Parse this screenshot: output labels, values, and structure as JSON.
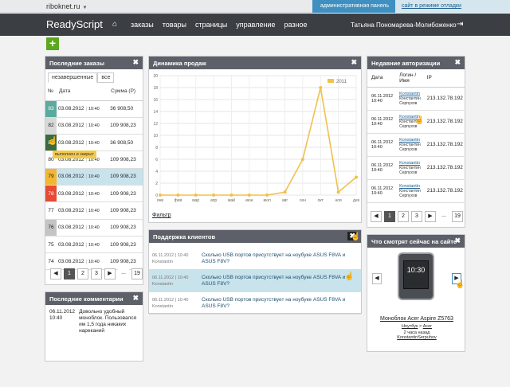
{
  "topbar": {
    "site": "riboknet.ru",
    "admin_link": "административная панель",
    "view_link": "сайт в режиме отладки"
  },
  "navbar": {
    "logo": "ReadyScript",
    "menu": [
      "заказы",
      "товары",
      "страницы",
      "управление",
      "разное"
    ],
    "user": "Татьяна Пономарева-Молибоженко"
  },
  "orders": {
    "title": "Последние заказы",
    "tabs": [
      "незавершенные",
      "все"
    ],
    "columns": [
      "№",
      "Дата",
      "Сумма (Р)"
    ],
    "rows": [
      {
        "num": "83",
        "date": "03.08.2012",
        "time": "10:40",
        "sum": "36 908,50",
        "color": "#5aaa9f"
      },
      {
        "num": "82",
        "date": "03.08.2012",
        "time": "10:40",
        "sum": "109 908,23",
        "color": "#d8d8d8"
      },
      {
        "num": "81",
        "date": "03.08.2012",
        "time": "10:40",
        "sum": "36 908,50",
        "color": "#3a6b3e"
      },
      {
        "num": "80",
        "date": "03.08.2012",
        "time": "10:40",
        "sum": "109 908,23",
        "color": "#ffffff"
      },
      {
        "num": "79",
        "date": "03.08.2012",
        "time": "10:40",
        "sum": "109 908,23",
        "color": "#f2b632"
      },
      {
        "num": "78",
        "date": "03.08.2012",
        "time": "10:40",
        "sum": "109 908,23",
        "color": "#e64b36"
      },
      {
        "num": "77",
        "date": "03.08.2012",
        "time": "10:40",
        "sum": "109 908,23",
        "color": "#ffffff"
      },
      {
        "num": "76",
        "date": "03.08.2012",
        "time": "10:40",
        "sum": "109 908,23",
        "color": "#c4c4c4"
      },
      {
        "num": "75",
        "date": "03.08.2012",
        "time": "10:40",
        "sum": "109 908,23",
        "color": "#ffffff"
      },
      {
        "num": "74",
        "date": "03.08.2012",
        "time": "10:40",
        "sum": "109 908,23",
        "color": "#ffffff"
      }
    ],
    "tooltip": "выполнен и закрыт",
    "pager": [
      "◀",
      "1",
      "2",
      "3",
      "▶",
      "...",
      "19"
    ]
  },
  "comments": {
    "title": "Последние комментарии",
    "items": [
      {
        "date": "06.11.2012",
        "time": "10:40",
        "text": "Довольно удобный моноблок. Пользовался им 1,5 года никаких нареканий"
      }
    ]
  },
  "sales": {
    "title": "Динамика продаж",
    "filter": "Фильтр"
  },
  "chart_data": {
    "type": "line",
    "categories": [
      "янв",
      "фев",
      "мар",
      "апр",
      "май",
      "июн",
      "июл",
      "авг",
      "сен",
      "окт",
      "ноя",
      "дек"
    ],
    "series": [
      {
        "name": "2011",
        "values": [
          0,
          0,
          0,
          0,
          0,
          0,
          0,
          0.5,
          6,
          18,
          0.5,
          3
        ]
      }
    ],
    "ylim": [
      0,
      20
    ],
    "yticks": [
      0,
      2,
      4,
      6,
      8,
      10,
      12,
      14,
      16,
      18,
      20
    ],
    "legend": "top-right",
    "grid": true,
    "color": "#f0c14b"
  },
  "support": {
    "title": "Поддержка клиентов",
    "items": [
      {
        "date": "06.11.2012",
        "time": "10:40",
        "user": "Konstantin",
        "text": "Сколько USB портов присутствует на ноубуке ASUS F8VA и ASUS F8V?"
      },
      {
        "date": "06.11.2012",
        "time": "10:40",
        "user": "Konstantin",
        "text": "Сколько USB портов присутствует на ноубуке ASUS F8VA и ASUS F8V?"
      },
      {
        "date": "06.11.2012",
        "time": "10:40",
        "user": "Konstantin",
        "text": "Сколько USB портов присутствует на ноубуке ASUS F8VA и ASUS F8V?"
      }
    ]
  },
  "auth": {
    "title": "Недавние авторизации",
    "columns": [
      "Дата",
      "Логин / Имя",
      "IP"
    ],
    "rows": [
      {
        "date": "06.11.2012",
        "time": "10:40",
        "login": "Konstantin",
        "name": "Константин Серпухов",
        "ip": "213.132.78.192"
      },
      {
        "date": "06.11.2012",
        "time": "10:40",
        "login": "Konstantin",
        "name": "Константин Серпухов",
        "ip": "213.132.78.192"
      },
      {
        "date": "06.11.2012",
        "time": "10:40",
        "login": "Konstantin",
        "name": "Константин Серпухов",
        "ip": "213.132.78.192"
      },
      {
        "date": "06.11.2012",
        "time": "10:40",
        "login": "Konstantin",
        "name": "Константин Серпухов",
        "ip": "213.132.78.192"
      },
      {
        "date": "06.11.2012",
        "time": "10:40",
        "login": "Konstantin",
        "name": "Константин Серпухов",
        "ip": "213.132.78.192"
      }
    ],
    "pager": [
      "◀",
      "1",
      "2",
      "3",
      "▶",
      "...",
      "19"
    ]
  },
  "watching": {
    "title": "Что смотрят сейчас на сайте",
    "product": "Моноблок Acer Aspire Z5763",
    "breadcrumb_a": "Ноутбук",
    "breadcrumb_b": "Acer",
    "ago": "2 часа назад",
    "user": "KonstantinSerpuhov"
  }
}
